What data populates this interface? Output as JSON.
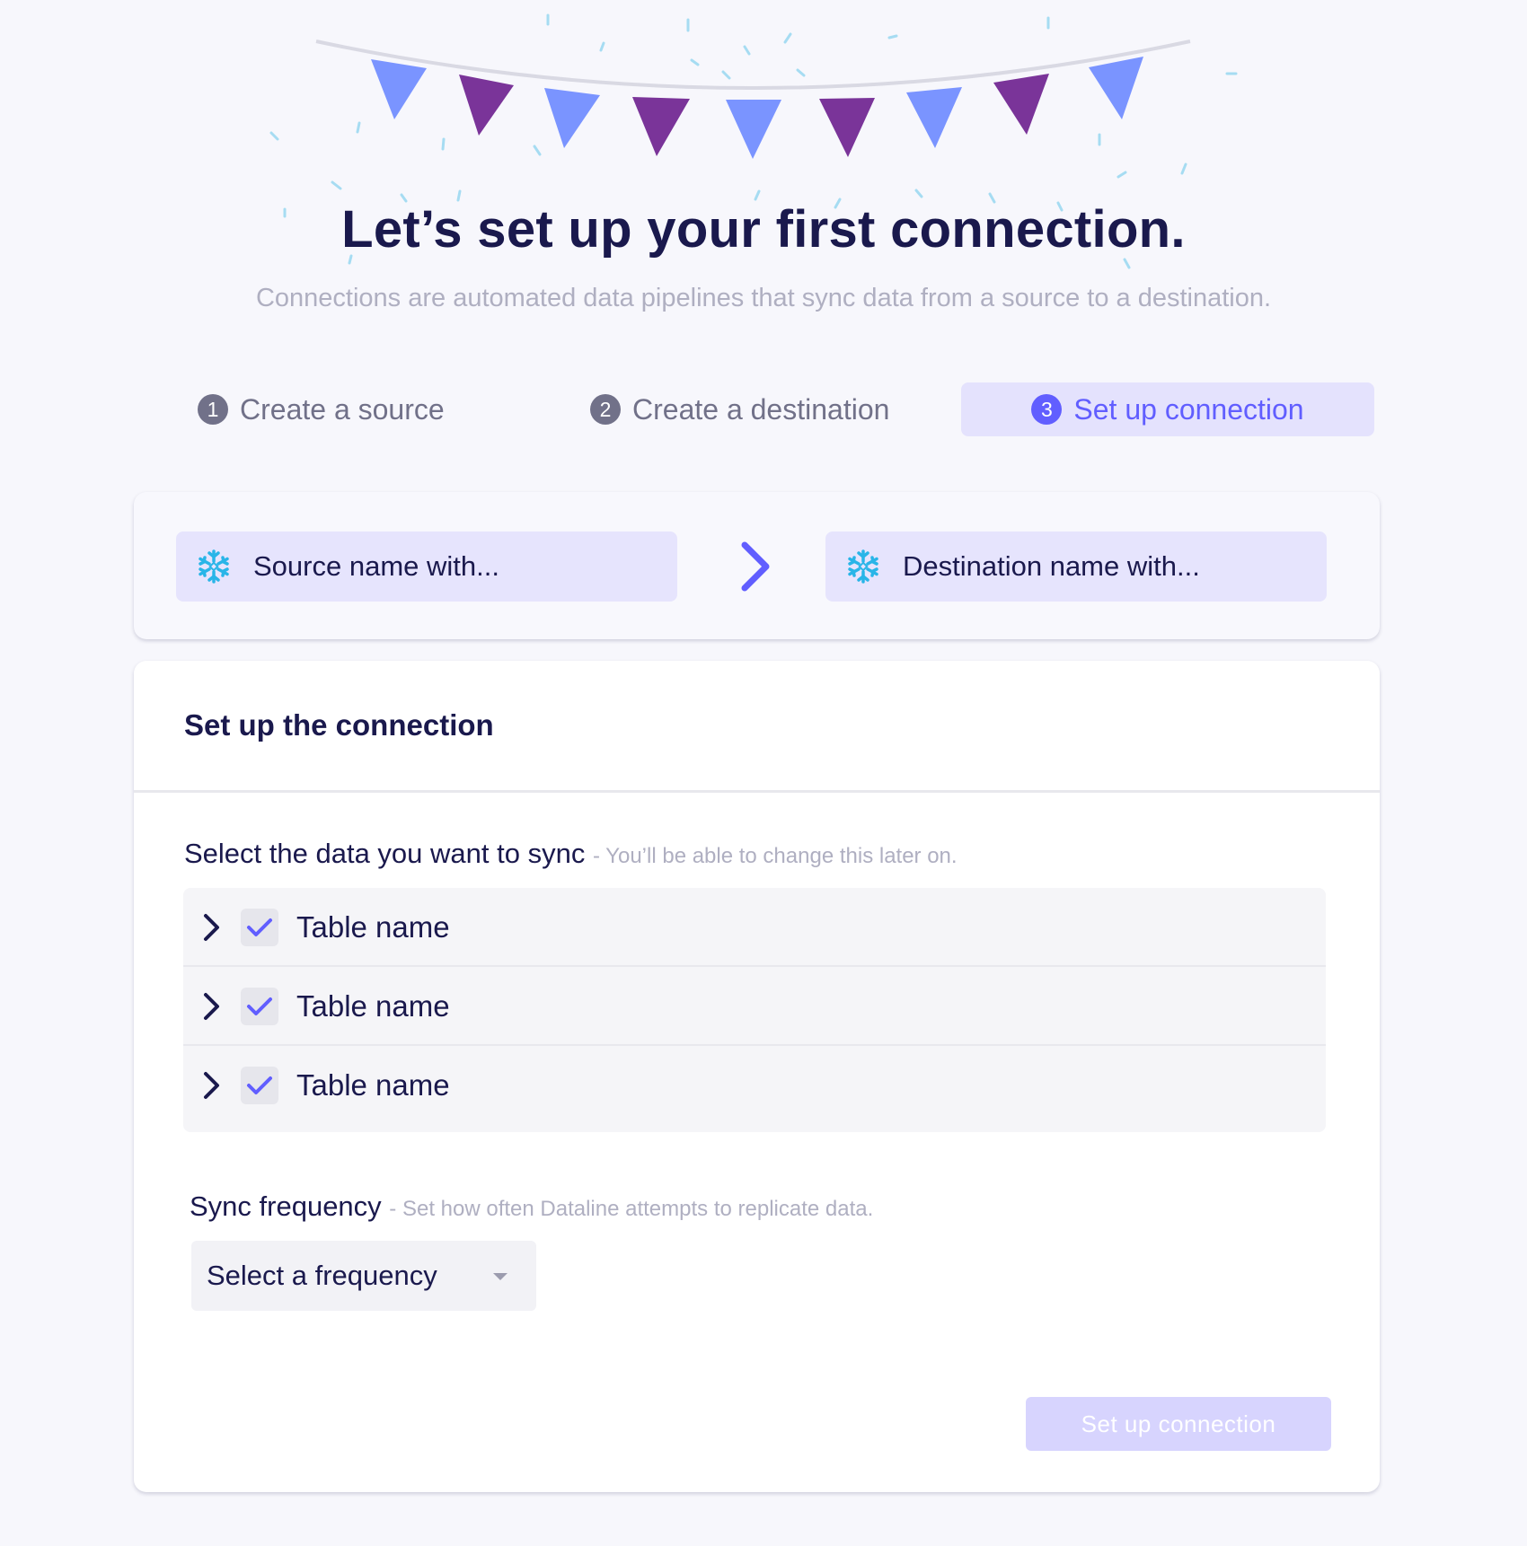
{
  "hero": {
    "title": "Let’s set up your first connection.",
    "subtitle": "Connections are automated data pipelines that sync data from a source to a destination."
  },
  "steps": [
    {
      "number": "1",
      "label": "Create a source",
      "state": "done"
    },
    {
      "number": "2",
      "label": "Create a destination",
      "state": "done"
    },
    {
      "number": "3",
      "label": "Set up connection",
      "state": "active"
    }
  ],
  "connection_summary": {
    "source": {
      "icon": "snowflake-icon",
      "label": "Source name with..."
    },
    "destination": {
      "icon": "snowflake-icon",
      "label": "Destination name with..."
    },
    "arrow_icon": "chevron-right-icon"
  },
  "setup": {
    "title": "Set up the connection",
    "data_label": "Select the data you want to sync",
    "data_hint": "- You’ll be able to change this later on.",
    "tables": [
      {
        "name": "Table name",
        "checked": true
      },
      {
        "name": "Table name",
        "checked": true
      },
      {
        "name": "Table name",
        "checked": true
      }
    ],
    "frequency_label": "Sync frequency",
    "frequency_hint": "- Set how often Dataline attempts to replicate data.",
    "frequency_placeholder": "Select a frequency",
    "submit_label": "Set up connection"
  },
  "colors": {
    "navy": "#1a194d",
    "accent": "#615eff",
    "bunting_blue": "#7a94ff",
    "bunting_purple": "#7a3499",
    "snowflake": "#29b5e8",
    "confetti": "#a6dcf2"
  }
}
